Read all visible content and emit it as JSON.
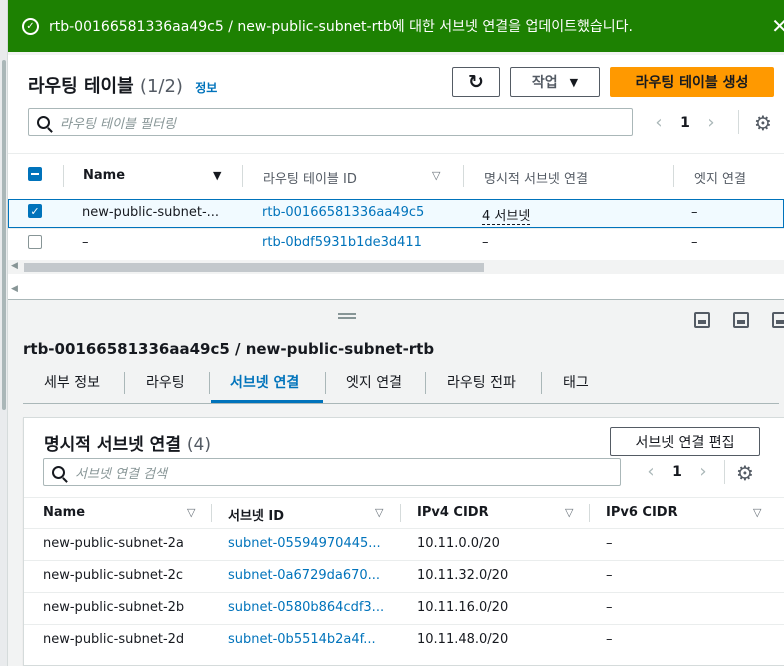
{
  "flash": {
    "message": "rtb-00166581336aa49c5 / new-public-subnet-rtb에 대한 서브넷 연결을 업데이트했습니다.",
    "icon": "check-circle-icon",
    "color": "#1d8102"
  },
  "route_tables": {
    "title": "라우팅 테이블",
    "count": "(1/2)",
    "info": "정보",
    "refresh_icon": "refresh-icon",
    "actions_label": "작업",
    "create_label": "라우팅 테이블 생성",
    "search_placeholder": "라우팅 테이블 필터링",
    "page": "1",
    "columns": [
      "Name",
      "라우팅 테이블 ID",
      "명시적 서브넷 연결",
      "엣지 연결"
    ],
    "rows": [
      {
        "name": "new-public-subnet-...",
        "id": "rtb-00166581336aa49c5",
        "explicit": "4 서브넷",
        "edge": "–",
        "selected": true
      },
      {
        "name": "–",
        "id": "rtb-0bdf5931b1de3d411",
        "explicit": "–",
        "edge": "–",
        "selected": false
      }
    ]
  },
  "detail": {
    "title": "rtb-00166581336aa49c5 / new-public-subnet-rtb",
    "tabs": [
      "세부 정보",
      "라우팅",
      "서브넷 연결",
      "엣지 연결",
      "라우팅 전파",
      "태그"
    ],
    "active_tab": "서브넷 연결"
  },
  "subnet_assoc": {
    "title": "명시적 서브넷 연결",
    "count": "(4)",
    "edit_label": "서브넷 연결 편집",
    "search_placeholder": "서브넷 연결 검색",
    "page": "1",
    "columns": [
      "Name",
      "서브넷 ID",
      "IPv4 CIDR",
      "IPv6 CIDR"
    ],
    "rows": [
      {
        "name": "new-public-subnet-2a",
        "id": "subnet-05594970445...",
        "ipv4": "10.11.0.0/20",
        "ipv6": "–"
      },
      {
        "name": "new-public-subnet-2c",
        "id": "subnet-0a6729da670...",
        "ipv4": "10.11.32.0/20",
        "ipv6": "–"
      },
      {
        "name": "new-public-subnet-2b",
        "id": "subnet-0580b864cdf3...",
        "ipv4": "10.11.16.0/20",
        "ipv6": "–"
      },
      {
        "name": "new-public-subnet-2d",
        "id": "subnet-0b5514b2a4f...",
        "ipv4": "10.11.48.0/20",
        "ipv6": "–"
      }
    ]
  },
  "colors": {
    "accent": "#0073bb",
    "primary_button": "#ff9900",
    "success": "#1d8102"
  }
}
